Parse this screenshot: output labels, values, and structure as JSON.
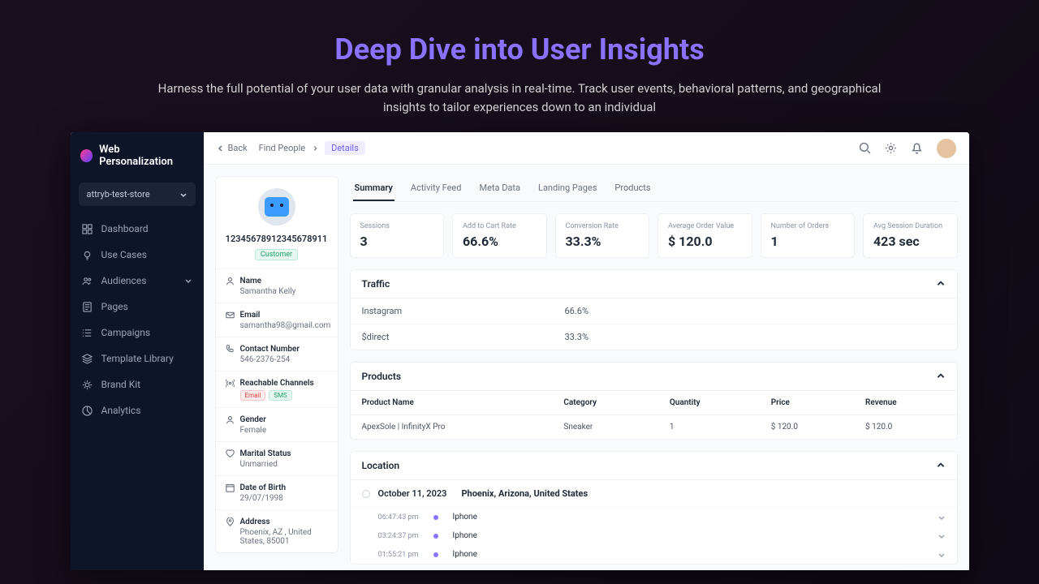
{
  "hero": {
    "title": "Deep Dive into User Insights",
    "subtitle": "Harness the full potential of your user data with granular analysis in real-time. Track user events, behavioral patterns, and geographical insights to tailor experiences down to an individual"
  },
  "sidebar": {
    "brand": "Web Personalization",
    "store": "attryb-test-store",
    "items": [
      "Dashboard",
      "Use Cases",
      "Audiences",
      "Pages",
      "Campaigns",
      "Template Library",
      "Brand Kit",
      "Analytics"
    ]
  },
  "topbar": {
    "back": "Back",
    "crumb1": "Find People",
    "crumb2": "Details"
  },
  "profile": {
    "id": "12345678912345678911",
    "badge": "Customer",
    "fields": {
      "name_label": "Name",
      "name_value": "Samantha Kelly",
      "email_label": "Email",
      "email_value": "samantha98@gmail.com",
      "contact_label": "Contact Number",
      "contact_value": "546-2376-254",
      "channels_label": "Reachable Channels",
      "channel_email": "Email",
      "channel_sms": "SMS",
      "gender_label": "Gender",
      "gender_value": "Female",
      "marital_label": "Marital Status",
      "marital_value": "Unmarried",
      "dob_label": "Date of Birth",
      "dob_value": "29/07/1998",
      "address_label": "Address",
      "address_value": "Phoenix, AZ , United States, 85001"
    }
  },
  "tabs": [
    "Summary",
    "Activity Feed",
    "Meta Data",
    "Landing Pages",
    "Products"
  ],
  "metrics": [
    {
      "label": "Sessions",
      "value": "3"
    },
    {
      "label": "Add to Cart Rate",
      "value": "66.6%"
    },
    {
      "label": "Conversion Rate",
      "value": "33.3%"
    },
    {
      "label": "Average Order Value",
      "value": "$ 120.0"
    },
    {
      "label": "Number of Orders",
      "value": "1"
    },
    {
      "label": "Avg Session Duration",
      "value": "423 sec"
    }
  ],
  "traffic": {
    "title": "Traffic",
    "rows": [
      {
        "src": "Instagram",
        "val": "66.6%"
      },
      {
        "src": "$direct",
        "val": "33.3%"
      }
    ]
  },
  "products": {
    "title": "Products",
    "headers": [
      "Product Name",
      "Category",
      "Quantity",
      "Price",
      "Revenue"
    ],
    "rows": [
      {
        "name": "ApexSole | InfinityX Pro",
        "category": "Sneaker",
        "qty": "1",
        "price": "$ 120.0",
        "revenue": "$ 120.0"
      }
    ]
  },
  "location": {
    "title": "Location",
    "date": "October 11, 2023",
    "place": "Phoenix, Arizona, United States",
    "events": [
      {
        "time": "06:47:43 pm",
        "device": "Iphone"
      },
      {
        "time": "03:24:37 pm",
        "device": "Iphone"
      },
      {
        "time": "01:55:21 pm",
        "device": "Iphone"
      }
    ]
  }
}
